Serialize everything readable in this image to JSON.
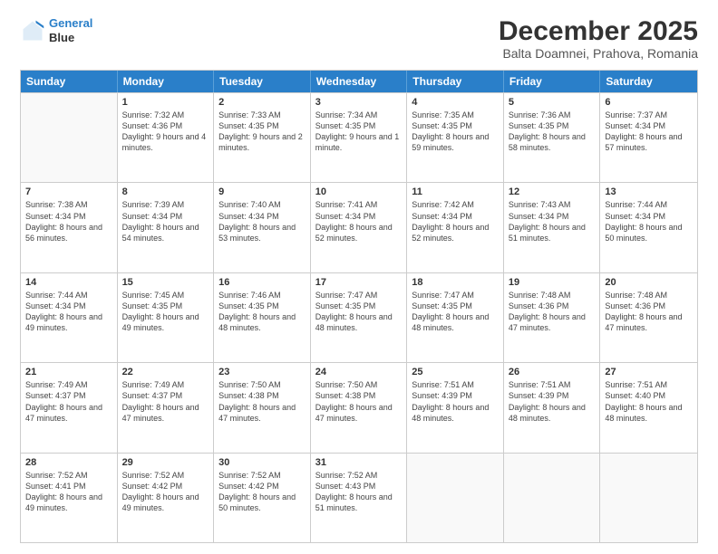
{
  "header": {
    "logo_line1": "General",
    "logo_line2": "Blue",
    "main_title": "December 2025",
    "subtitle": "Balta Doamnei, Prahova, Romania"
  },
  "days": [
    "Sunday",
    "Monday",
    "Tuesday",
    "Wednesday",
    "Thursday",
    "Friday",
    "Saturday"
  ],
  "weeks": [
    [
      {
        "day": "",
        "empty": true
      },
      {
        "day": "1",
        "sunrise": "7:32 AM",
        "sunset": "4:36 PM",
        "daylight": "9 hours and 4 minutes."
      },
      {
        "day": "2",
        "sunrise": "7:33 AM",
        "sunset": "4:35 PM",
        "daylight": "9 hours and 2 minutes."
      },
      {
        "day": "3",
        "sunrise": "7:34 AM",
        "sunset": "4:35 PM",
        "daylight": "9 hours and 1 minute."
      },
      {
        "day": "4",
        "sunrise": "7:35 AM",
        "sunset": "4:35 PM",
        "daylight": "8 hours and 59 minutes."
      },
      {
        "day": "5",
        "sunrise": "7:36 AM",
        "sunset": "4:35 PM",
        "daylight": "8 hours and 58 minutes."
      },
      {
        "day": "6",
        "sunrise": "7:37 AM",
        "sunset": "4:34 PM",
        "daylight": "8 hours and 57 minutes."
      }
    ],
    [
      {
        "day": "7",
        "sunrise": "7:38 AM",
        "sunset": "4:34 PM",
        "daylight": "8 hours and 56 minutes."
      },
      {
        "day": "8",
        "sunrise": "7:39 AM",
        "sunset": "4:34 PM",
        "daylight": "8 hours and 54 minutes."
      },
      {
        "day": "9",
        "sunrise": "7:40 AM",
        "sunset": "4:34 PM",
        "daylight": "8 hours and 53 minutes."
      },
      {
        "day": "10",
        "sunrise": "7:41 AM",
        "sunset": "4:34 PM",
        "daylight": "8 hours and 52 minutes."
      },
      {
        "day": "11",
        "sunrise": "7:42 AM",
        "sunset": "4:34 PM",
        "daylight": "8 hours and 52 minutes."
      },
      {
        "day": "12",
        "sunrise": "7:43 AM",
        "sunset": "4:34 PM",
        "daylight": "8 hours and 51 minutes."
      },
      {
        "day": "13",
        "sunrise": "7:44 AM",
        "sunset": "4:34 PM",
        "daylight": "8 hours and 50 minutes."
      }
    ],
    [
      {
        "day": "14",
        "sunrise": "7:44 AM",
        "sunset": "4:34 PM",
        "daylight": "8 hours and 49 minutes."
      },
      {
        "day": "15",
        "sunrise": "7:45 AM",
        "sunset": "4:35 PM",
        "daylight": "8 hours and 49 minutes."
      },
      {
        "day": "16",
        "sunrise": "7:46 AM",
        "sunset": "4:35 PM",
        "daylight": "8 hours and 48 minutes."
      },
      {
        "day": "17",
        "sunrise": "7:47 AM",
        "sunset": "4:35 PM",
        "daylight": "8 hours and 48 minutes."
      },
      {
        "day": "18",
        "sunrise": "7:47 AM",
        "sunset": "4:35 PM",
        "daylight": "8 hours and 48 minutes."
      },
      {
        "day": "19",
        "sunrise": "7:48 AM",
        "sunset": "4:36 PM",
        "daylight": "8 hours and 47 minutes."
      },
      {
        "day": "20",
        "sunrise": "7:48 AM",
        "sunset": "4:36 PM",
        "daylight": "8 hours and 47 minutes."
      }
    ],
    [
      {
        "day": "21",
        "sunrise": "7:49 AM",
        "sunset": "4:37 PM",
        "daylight": "8 hours and 47 minutes."
      },
      {
        "day": "22",
        "sunrise": "7:49 AM",
        "sunset": "4:37 PM",
        "daylight": "8 hours and 47 minutes."
      },
      {
        "day": "23",
        "sunrise": "7:50 AM",
        "sunset": "4:38 PM",
        "daylight": "8 hours and 47 minutes."
      },
      {
        "day": "24",
        "sunrise": "7:50 AM",
        "sunset": "4:38 PM",
        "daylight": "8 hours and 47 minutes."
      },
      {
        "day": "25",
        "sunrise": "7:51 AM",
        "sunset": "4:39 PM",
        "daylight": "8 hours and 48 minutes."
      },
      {
        "day": "26",
        "sunrise": "7:51 AM",
        "sunset": "4:39 PM",
        "daylight": "8 hours and 48 minutes."
      },
      {
        "day": "27",
        "sunrise": "7:51 AM",
        "sunset": "4:40 PM",
        "daylight": "8 hours and 48 minutes."
      }
    ],
    [
      {
        "day": "28",
        "sunrise": "7:52 AM",
        "sunset": "4:41 PM",
        "daylight": "8 hours and 49 minutes."
      },
      {
        "day": "29",
        "sunrise": "7:52 AM",
        "sunset": "4:42 PM",
        "daylight": "8 hours and 49 minutes."
      },
      {
        "day": "30",
        "sunrise": "7:52 AM",
        "sunset": "4:42 PM",
        "daylight": "8 hours and 50 minutes."
      },
      {
        "day": "31",
        "sunrise": "7:52 AM",
        "sunset": "4:43 PM",
        "daylight": "8 hours and 51 minutes."
      },
      {
        "day": "",
        "empty": true
      },
      {
        "day": "",
        "empty": true
      },
      {
        "day": "",
        "empty": true
      }
    ]
  ],
  "labels": {
    "sunrise": "Sunrise:",
    "sunset": "Sunset:",
    "daylight": "Daylight:"
  }
}
